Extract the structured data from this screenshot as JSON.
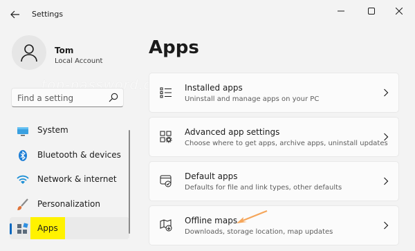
{
  "window": {
    "title": "Settings"
  },
  "user": {
    "name": "Tom",
    "account_type": "Local Account"
  },
  "search": {
    "placeholder": "Find a setting"
  },
  "watermark": "top-password.com",
  "nav": {
    "items": [
      {
        "label": "System",
        "icon": "monitor-icon",
        "active": false
      },
      {
        "label": "Bluetooth & devices",
        "icon": "bluetooth-icon",
        "active": false
      },
      {
        "label": "Network & internet",
        "icon": "wifi-icon",
        "active": false
      },
      {
        "label": "Personalization",
        "icon": "brush-icon",
        "active": false
      },
      {
        "label": "Apps",
        "icon": "apps-icon",
        "active": true
      }
    ]
  },
  "page": {
    "title": "Apps"
  },
  "cards": [
    {
      "title": "Installed apps",
      "desc": "Uninstall and manage apps on your PC",
      "icon": "installed-apps-icon"
    },
    {
      "title": "Advanced app settings",
      "desc": "Choose where to get apps, archive apps, uninstall updates",
      "icon": "advanced-settings-icon"
    },
    {
      "title": "Default apps",
      "desc": "Defaults for file and link types, other defaults",
      "icon": "default-apps-icon"
    },
    {
      "title": "Offline maps",
      "desc": "Downloads, storage location, map updates",
      "icon": "offline-maps-icon"
    }
  ],
  "colors": {
    "accent": "#0067c0",
    "highlight": "#fff200",
    "annotation_arrow": "#f5a65b"
  }
}
